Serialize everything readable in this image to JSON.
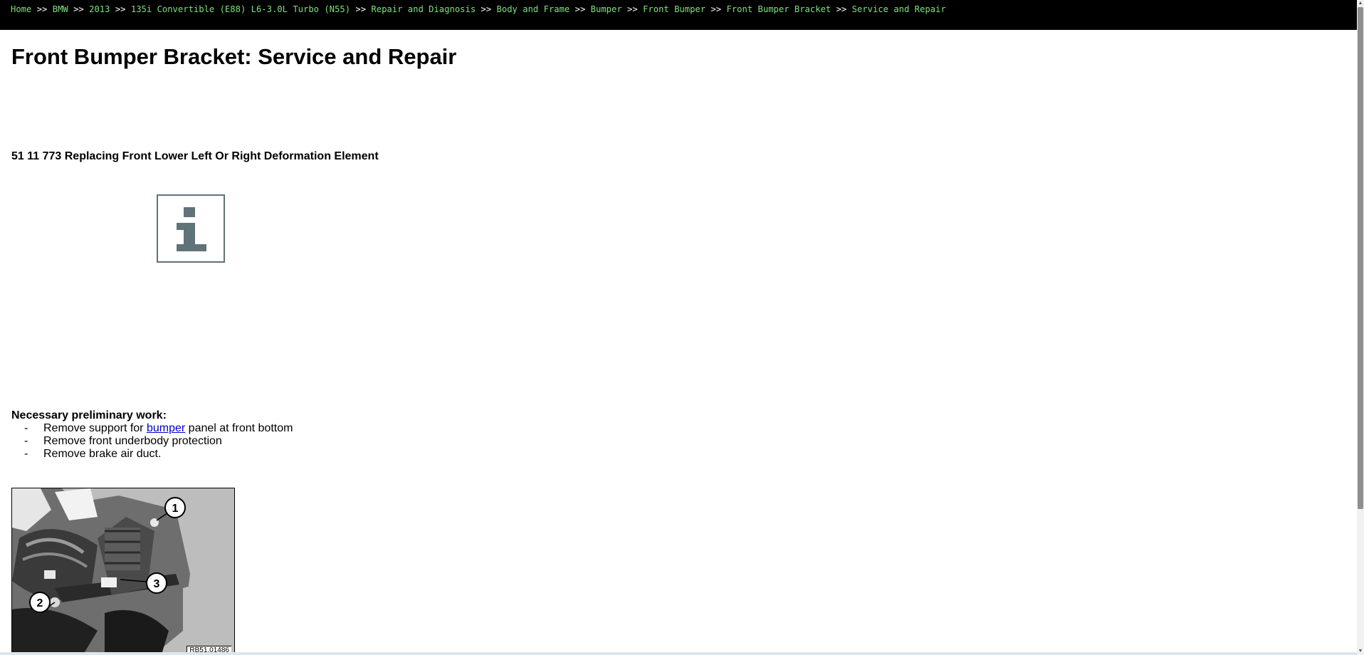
{
  "breadcrumb": {
    "separator": ">>",
    "items": [
      "Home",
      "BMW",
      "2013",
      "135i Convertible (E88) L6-3.0L Turbo (N55)",
      "Repair and Diagnosis",
      "Body and Frame",
      "Bumper",
      "Front Bumper",
      "Front Bumper Bracket",
      "Service and Repair"
    ]
  },
  "page": {
    "title": "Front Bumper Bracket: Service and Repair",
    "subheading": "51 11 773 Replacing Front Lower Left Or Right Deformation Element"
  },
  "info_icon": {
    "icon": "info-icon",
    "glyph": "i",
    "color": "#607378"
  },
  "preliminary": {
    "label": "Necessary preliminary work:",
    "dash": "-",
    "item1_before": "Remove support for",
    "item1_link": "bumper",
    "item1_after": "panel at front bottom",
    "item2": "Remove front underbody protection",
    "item3": "Remove brake air duct."
  },
  "figure": {
    "callouts": [
      "1",
      "2",
      "3"
    ],
    "ref": "RB51.01486"
  },
  "colors": {
    "topbar": "#000000",
    "breadcrumb_link": "#7ee07e",
    "link": "#0000cc"
  }
}
